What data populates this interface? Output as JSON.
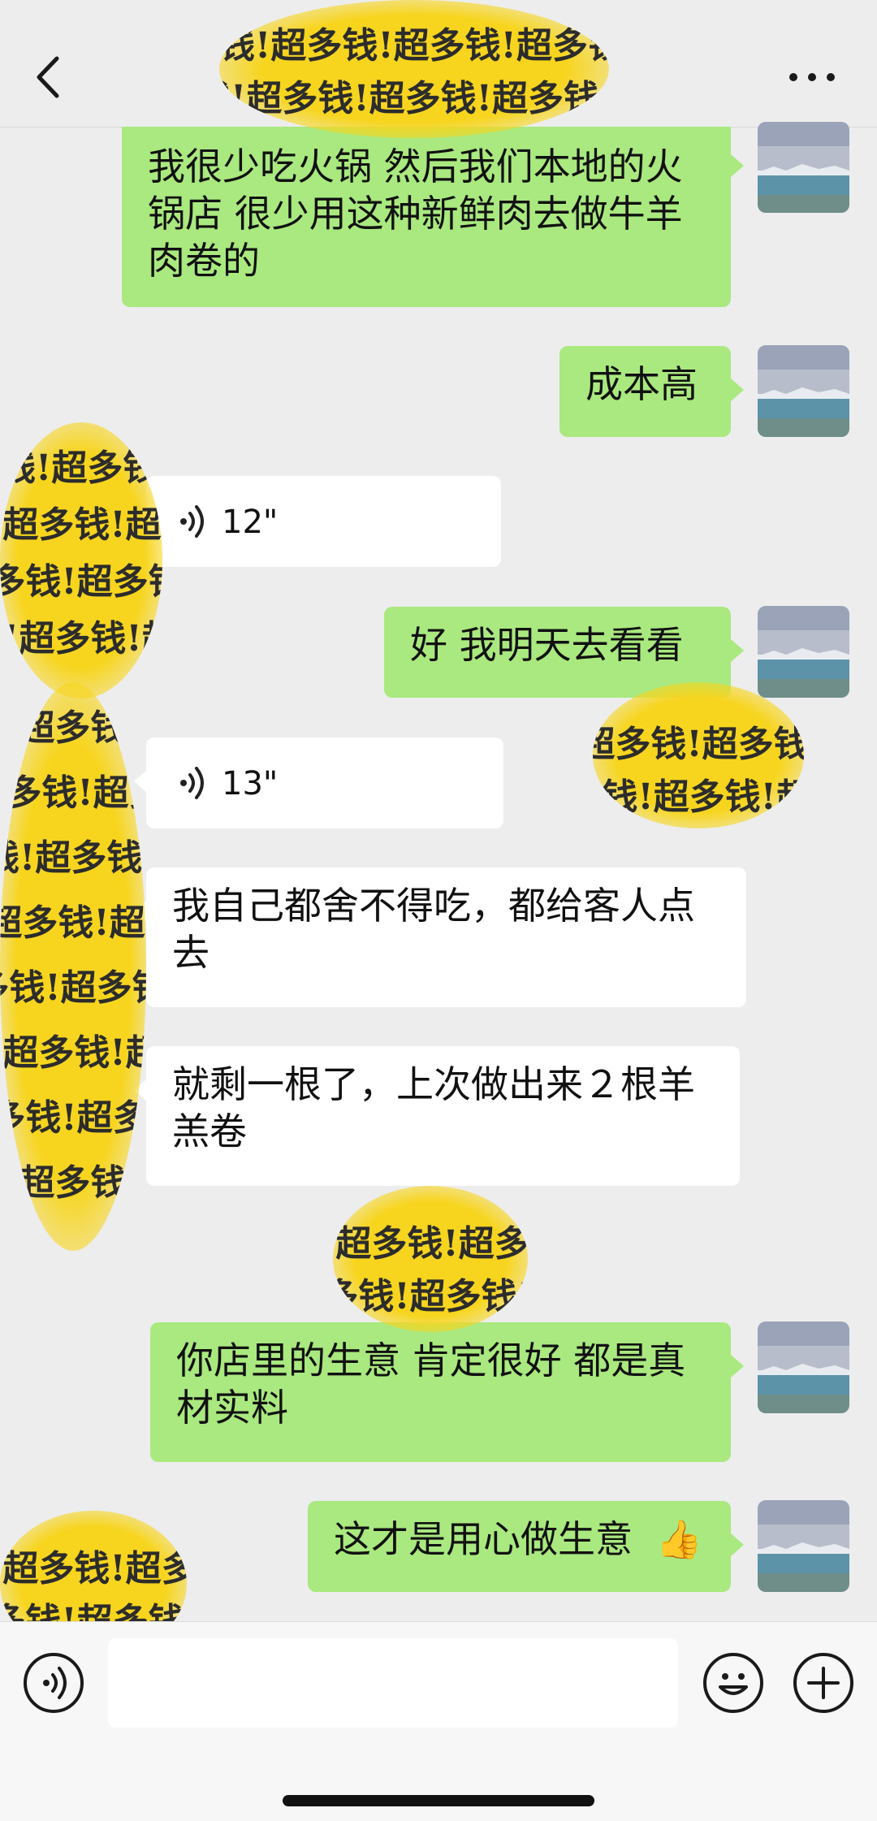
{
  "header": {
    "back_icon": "chevron-left-icon",
    "more_icon": "more-dots-icon",
    "sticker_text": "钱!超多钱!超多钱!超多钱!超"
  },
  "messages": [
    {
      "side": "right",
      "type": "text",
      "text": "我很少吃火锅 然后我们本地的火锅店 很少用这种新鲜肉去做牛羊肉卷的"
    },
    {
      "side": "right",
      "type": "text",
      "text": "成本高"
    },
    {
      "side": "left",
      "type": "voice",
      "text": "12\""
    },
    {
      "side": "right",
      "type": "text",
      "text": "好 我明天去看看"
    },
    {
      "side": "left",
      "type": "voice",
      "text": "13\""
    },
    {
      "side": "left",
      "type": "text",
      "text": "我自己都舍不得吃，都给客人点去"
    },
    {
      "side": "left",
      "type": "text",
      "text": "就剩一根了，上次做出来２根羊羔卷"
    },
    {
      "side": "right",
      "type": "text",
      "text": "你店里的生意 肯定很好 都是真材实料"
    },
    {
      "side": "right",
      "type": "text",
      "text": "这才是用心做生意",
      "emoji": "👍"
    }
  ],
  "input_bar": {
    "voice_icon": "voice-mode-icon",
    "placeholder": "",
    "emoji_icon": "emoji-icon",
    "plus_icon": "plus-icon"
  },
  "colors": {
    "background": "#EDEDED",
    "sent_bubble": "#A9E97F",
    "received_bubble": "#FFFFFF",
    "sticker": "#F7D51E"
  }
}
